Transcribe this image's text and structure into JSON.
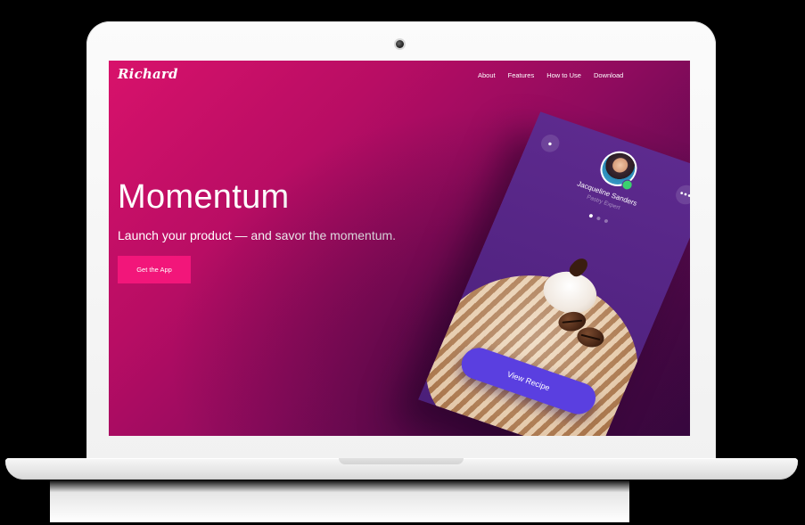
{
  "brand": {
    "logo_text": "Richard"
  },
  "nav": {
    "items": [
      {
        "label": "About"
      },
      {
        "label": "Features"
      },
      {
        "label": "How to Use"
      },
      {
        "label": "Download"
      }
    ]
  },
  "hero": {
    "title": "Momentum",
    "subtitle": "Launch your product — and savor the momentum.",
    "cta_label": "Get the App"
  },
  "phone": {
    "profile_name": "Jacqueline Sanders",
    "profile_role": "Pastry Expert",
    "view_recipe_label": "View Recipe",
    "more_icon": "more-horizontal-icon",
    "dot_icon": "dot-icon"
  },
  "colors": {
    "gradient_start": "#d8126b",
    "gradient_end": "#3a0842",
    "cta": "#f2167a",
    "phone_bg": "#5d2a8e",
    "view_recipe": "#5a3fe0"
  }
}
